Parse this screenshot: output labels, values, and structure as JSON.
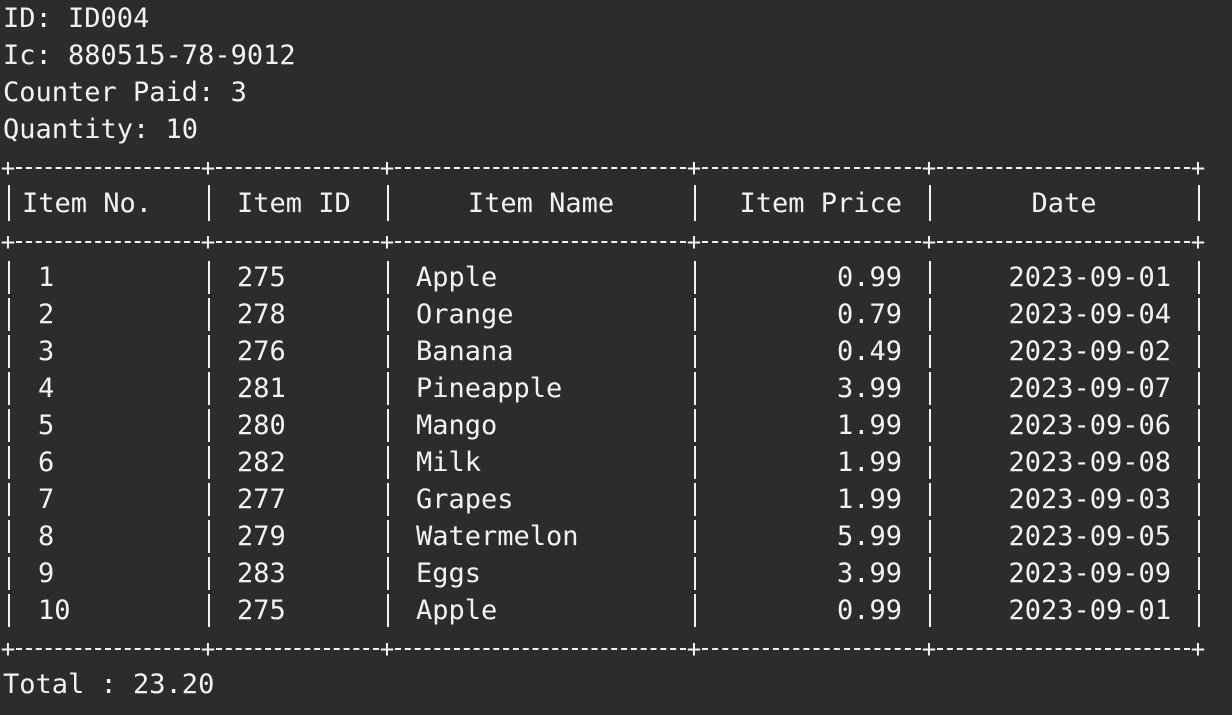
{
  "header": {
    "id_line": "ID: ID004",
    "ic_line": "Ic: 880515-78-9012",
    "counter_line": "Counter Paid: 3",
    "quantity_line": "Quantity: 10"
  },
  "table": {
    "columns": [
      "Item No.",
      "Item ID",
      "Item Name",
      "Item Price",
      "Date"
    ],
    "rows": [
      {
        "no": "1",
        "id": "275",
        "name": "Apple",
        "price": "0.99",
        "date": "2023-09-01"
      },
      {
        "no": "2",
        "id": "278",
        "name": "Orange",
        "price": "0.79",
        "date": "2023-09-04"
      },
      {
        "no": "3",
        "id": "276",
        "name": "Banana",
        "price": "0.49",
        "date": "2023-09-02"
      },
      {
        "no": "4",
        "id": "281",
        "name": "Pineapple",
        "price": "3.99",
        "date": "2023-09-07"
      },
      {
        "no": "5",
        "id": "280",
        "name": "Mango",
        "price": "1.99",
        "date": "2023-09-06"
      },
      {
        "no": "6",
        "id": "282",
        "name": "Milk",
        "price": "1.99",
        "date": "2023-09-08"
      },
      {
        "no": "7",
        "id": "277",
        "name": "Grapes",
        "price": "1.99",
        "date": "2023-09-03"
      },
      {
        "no": "8",
        "id": "279",
        "name": "Watermelon",
        "price": "5.99",
        "date": "2023-09-05"
      },
      {
        "no": "9",
        "id": "283",
        "name": "Eggs",
        "price": "3.99",
        "date": "2023-09-09"
      },
      {
        "no": "10",
        "id": "275",
        "name": "Apple",
        "price": "0.99",
        "date": "2023-09-01"
      }
    ]
  },
  "footer": {
    "total_line": "Total : 23.20"
  },
  "colors": {
    "background": "#2c2c2c",
    "foreground": "#f2f2f2"
  }
}
